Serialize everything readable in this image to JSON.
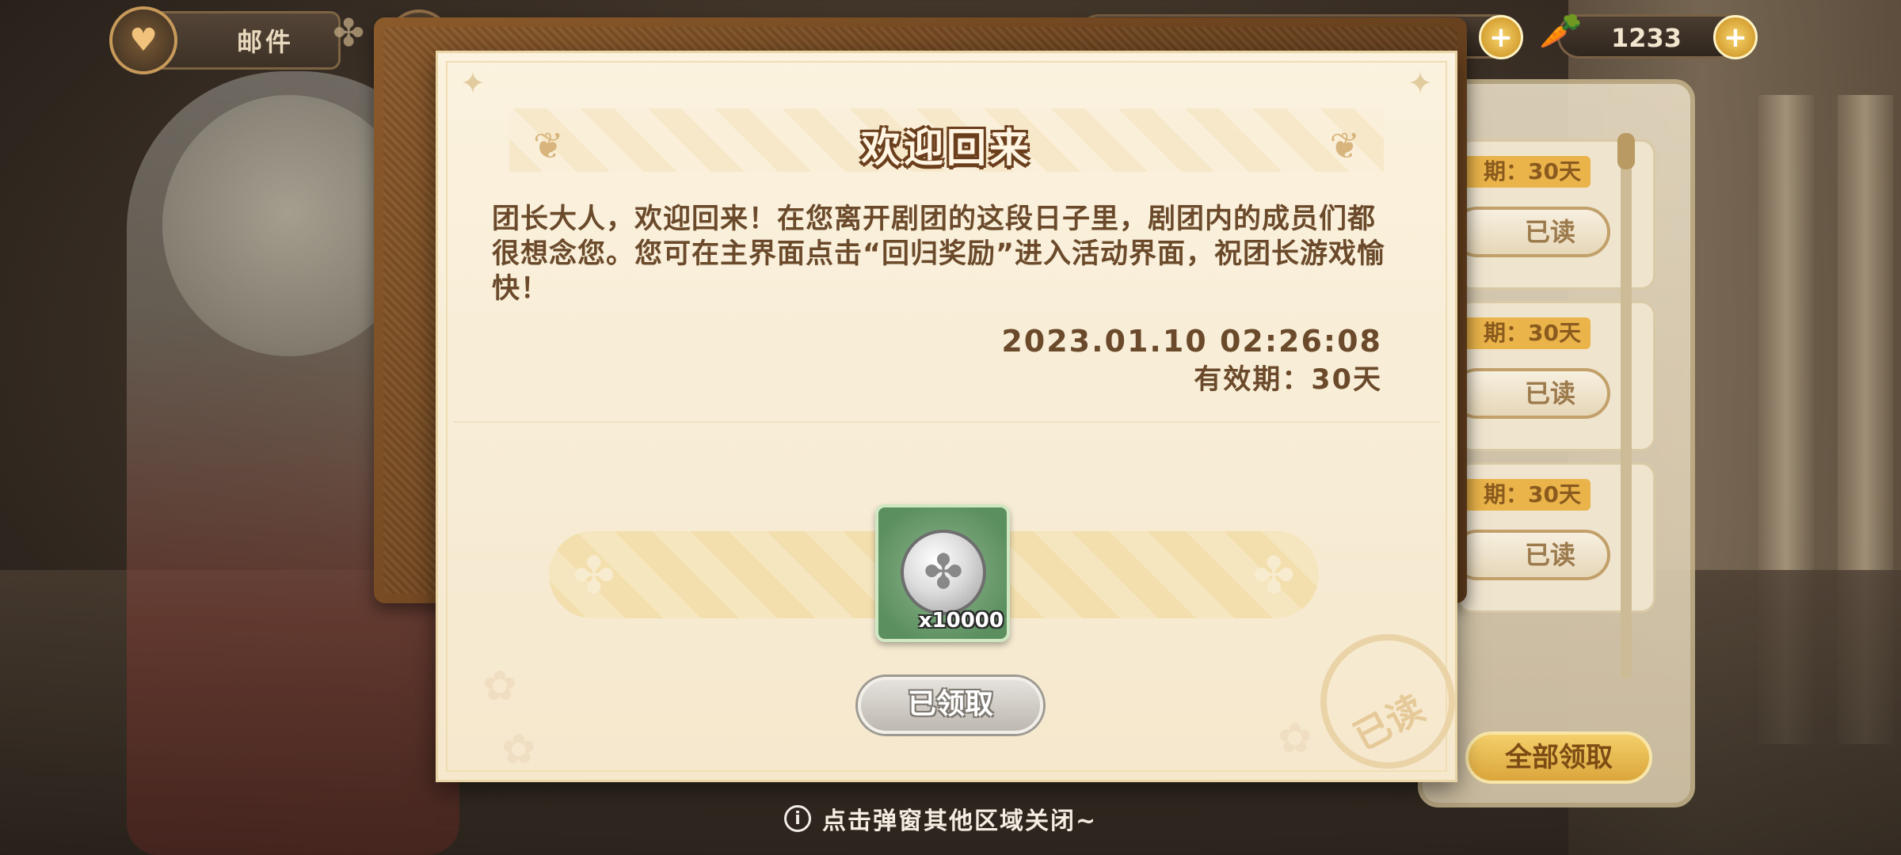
{
  "topbar": {
    "mail_title": "邮件",
    "currency_1_value": "",
    "currency_2_value": "1233"
  },
  "modal": {
    "title": "欢迎回来",
    "message": "团长大人，欢迎回来！在您离开剧团的这段日子里，剧团内的成员们都很想念您。您可在主界面点击“回归奖励”进入活动界面，祝团长游戏愉快！",
    "date": "2023.01.10 02:26:08",
    "expiry": "有效期：30天",
    "reward": {
      "icon": "clover-coin-icon",
      "quantity": "x10000"
    },
    "claimed_button": "已领取",
    "stamp_text": "已读"
  },
  "mail_list": {
    "items": [
      {
        "tag": "期：30天",
        "status": "已读"
      },
      {
        "tag": "期：30天",
        "status": "已读"
      },
      {
        "tag": "期：30天",
        "status": "已读"
      }
    ],
    "claim_all": "全部领取"
  },
  "footer": {
    "hint": "点击弹窗其他区域关闭~"
  },
  "colors": {
    "accent_text": "#6b4a2b",
    "title_outline": "#6b3f1d",
    "gold": "#dba63c",
    "reward_green": "#5b8f5f"
  }
}
